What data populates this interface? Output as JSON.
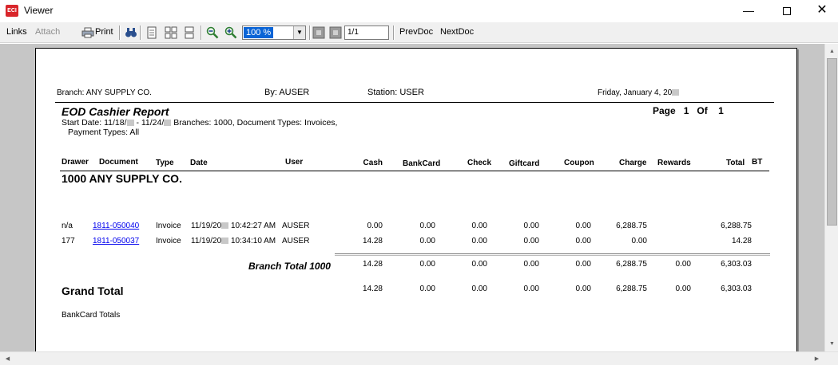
{
  "window": {
    "title": "Viewer",
    "icon": "eci-app-icon",
    "icon_text": "ECI"
  },
  "toolbar": {
    "links": "Links",
    "attach": "Attach",
    "print": "Print",
    "zoom": "100 %",
    "page": "1/1",
    "prev": "PrevDoc",
    "next": "NextDoc"
  },
  "report": {
    "branch_label": "Branch: ANY SUPPLY CO.",
    "by_label": "By: AUSER",
    "station_label": "Station:  USER",
    "date_label": "Friday, January 4, 20",
    "title": "EOD Cashier Report",
    "page_label": "Page",
    "page_num": "1",
    "of_label": "Of",
    "of_num": "1",
    "filter_line1_a": "Start Date: 11/18/",
    "filter_line1_b": " - 11/24/",
    "filter_line1_c": " Branches: 1000,  Document Types: Invoices,",
    "filter_line2": "Payment Types: All",
    "columns": {
      "drawer": "Drawer",
      "document": "Document",
      "type": "Type",
      "date": "Date",
      "user": "User",
      "cash": "Cash",
      "bankcard": "BankCard",
      "check": "Check",
      "giftcard": "Giftcard",
      "coupon": "Coupon",
      "charge": "Charge",
      "rewards": "Rewards",
      "total": "Total",
      "bt": "BT"
    },
    "branch_heading": "1000 ANY SUPPLY CO.",
    "rows": [
      {
        "drawer": "n/a",
        "document": "1811-050040",
        "type": "Invoice",
        "date_a": "11/19/20",
        "date_b": " 10:42:27 AM",
        "user": "AUSER",
        "cash": "0.00",
        "bankcard": "0.00",
        "check": "0.00",
        "giftcard": "0.00",
        "coupon": "0.00",
        "charge": "6,288.75",
        "rewards": "",
        "total": "6,288.75"
      },
      {
        "drawer": "177",
        "document": "1811-050037",
        "type": "Invoice",
        "date_a": "11/19/20",
        "date_b": " 10:34:10 AM",
        "user": "AUSER",
        "cash": "14.28",
        "bankcard": "0.00",
        "check": "0.00",
        "giftcard": "0.00",
        "coupon": "0.00",
        "charge": "0.00",
        "rewards": "",
        "total": "14.28"
      }
    ],
    "branch_total": {
      "label": "Branch Total 1000",
      "cash": "14.28",
      "bankcard": "0.00",
      "check": "0.00",
      "giftcard": "0.00",
      "coupon": "0.00",
      "charge": "6,288.75",
      "rewards": "0.00",
      "total": "6,303.03"
    },
    "grand_total": {
      "label": "Grand Total",
      "cash": "14.28",
      "bankcard": "0.00",
      "check": "0.00",
      "giftcard": "0.00",
      "coupon": "0.00",
      "charge": "6,288.75",
      "rewards": "0.00",
      "total": "6,303.03"
    },
    "bankcard_totals": "BankCard Totals"
  }
}
